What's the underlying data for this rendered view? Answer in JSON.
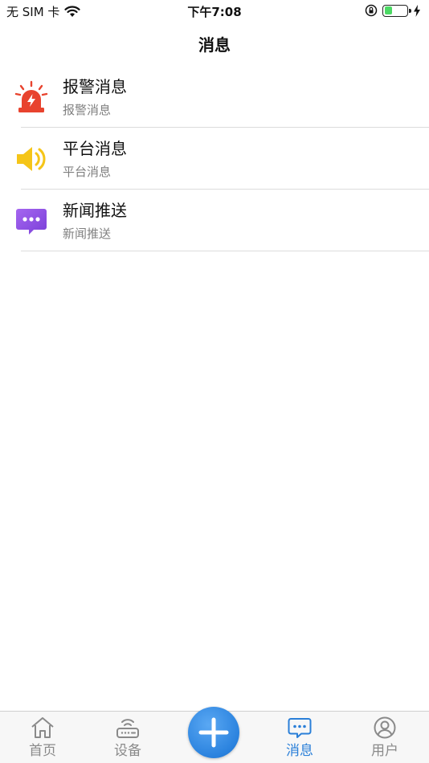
{
  "status_bar": {
    "carrier": "无 SIM 卡",
    "time": "下午7:08",
    "battery_level": 0.35
  },
  "nav": {
    "title": "消息"
  },
  "messages": [
    {
      "title": "报警消息",
      "subtitle": "报警消息",
      "icon": "alarm-siren-icon"
    },
    {
      "title": "平台消息",
      "subtitle": "平台消息",
      "icon": "speaker-icon"
    },
    {
      "title": "新闻推送",
      "subtitle": "新闻推送",
      "icon": "chat-bubble-icon"
    }
  ],
  "tabs": [
    {
      "label": "首页",
      "icon": "home-icon",
      "active": false
    },
    {
      "label": "设备",
      "icon": "router-icon",
      "active": false
    },
    {
      "label": "",
      "icon": "plus-icon",
      "active": false
    },
    {
      "label": "消息",
      "icon": "message-icon",
      "active": true
    },
    {
      "label": "用户",
      "icon": "user-icon",
      "active": false
    }
  ],
  "colors": {
    "accent": "#2a7fd8",
    "alarm": "#e8432e",
    "speaker": "#f5c518",
    "chat": "#8a4fe0",
    "battery": "#4cd964"
  }
}
